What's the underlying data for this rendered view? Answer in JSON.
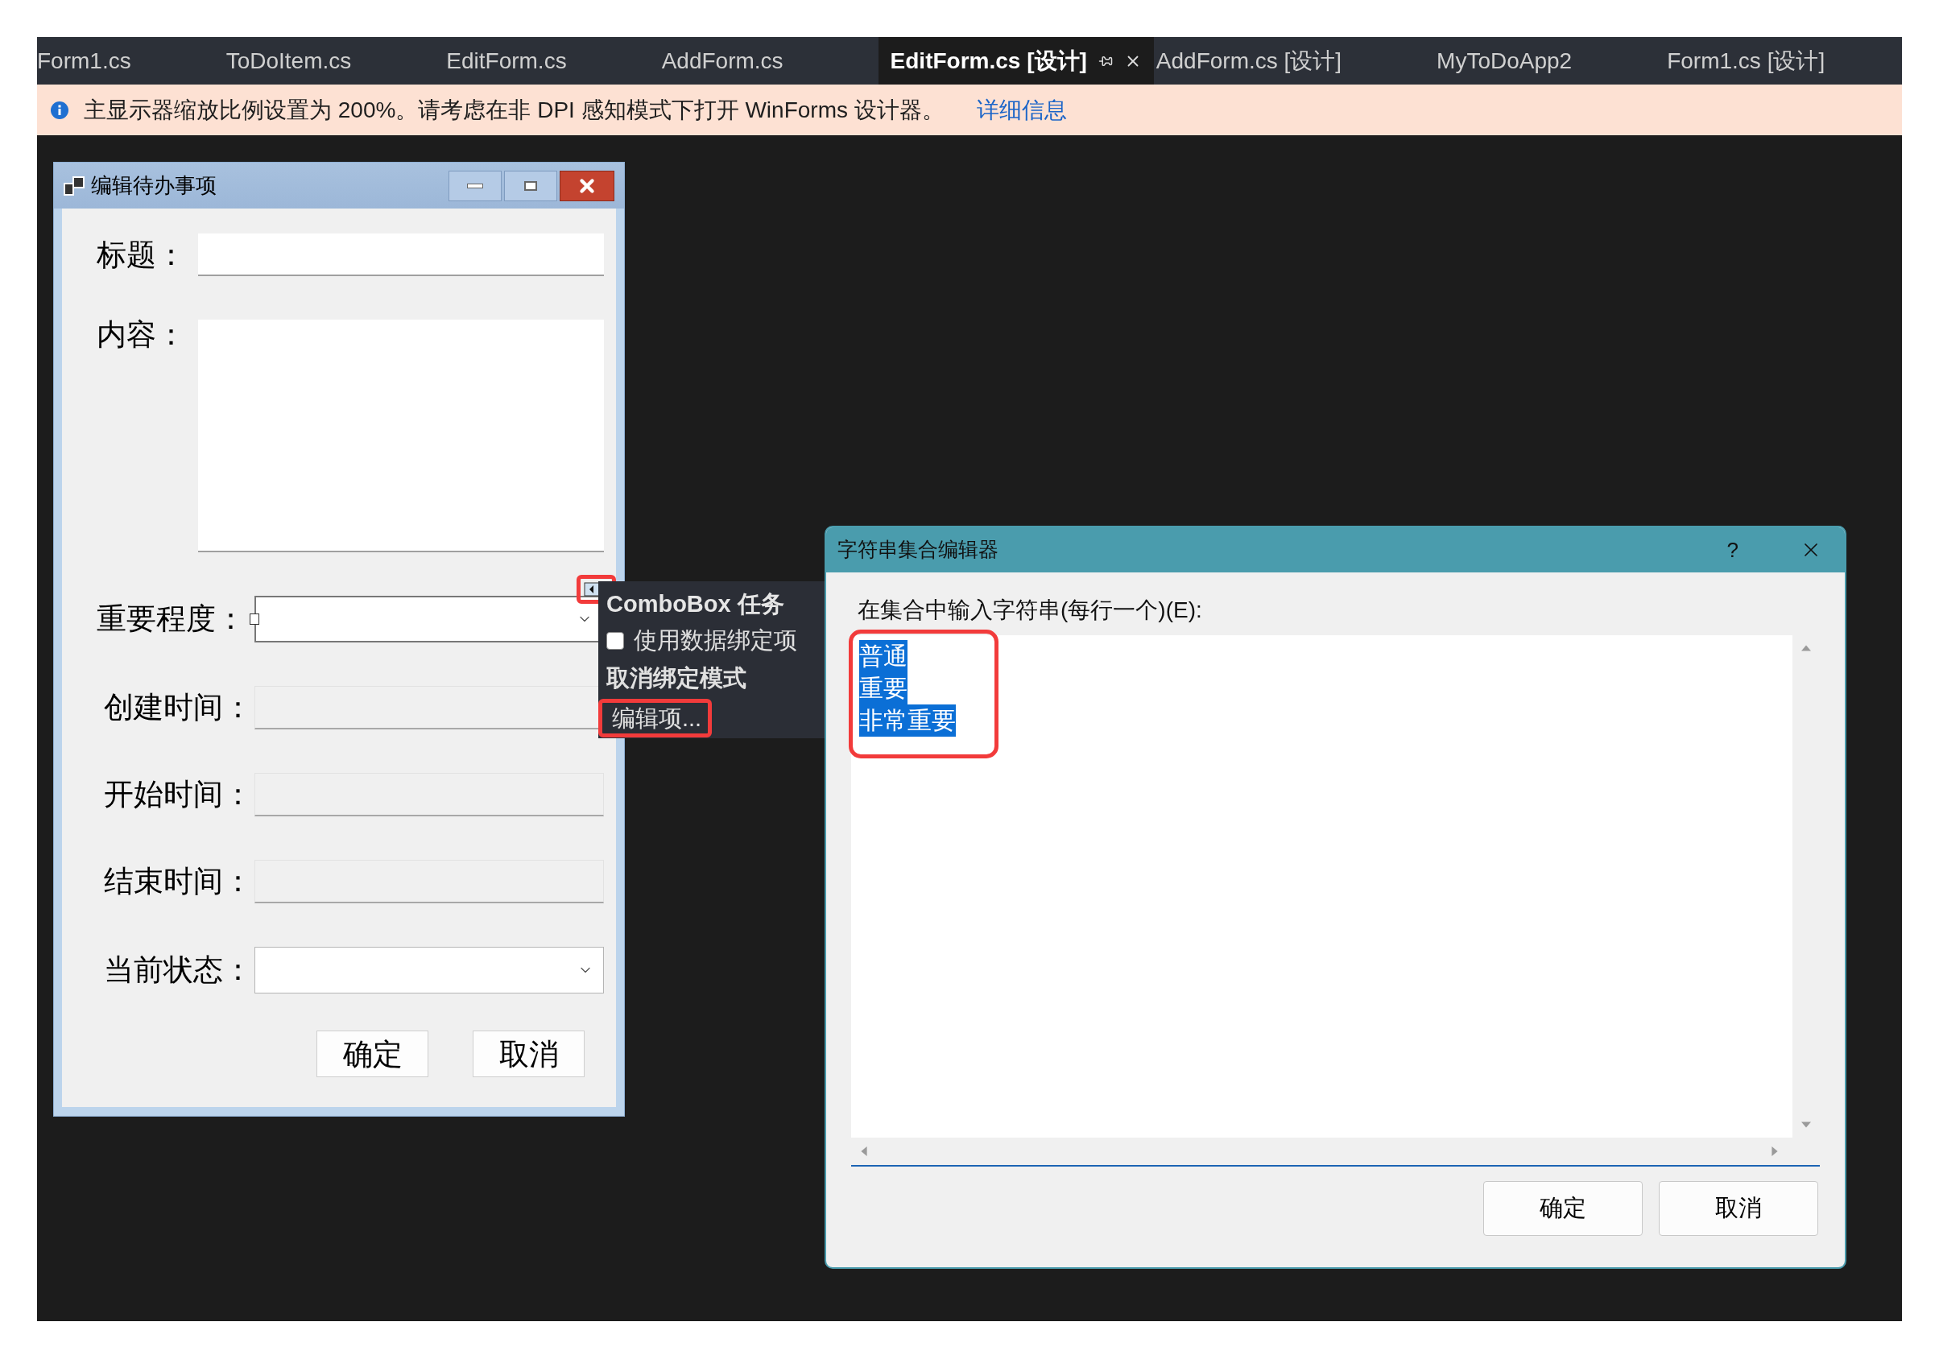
{
  "tabs": [
    {
      "label": "Form1.cs",
      "selected": false
    },
    {
      "label": "ToDoItem.cs",
      "selected": false
    },
    {
      "label": "EditForm.cs",
      "selected": false
    },
    {
      "label": "AddForm.cs",
      "selected": false
    },
    {
      "label": "EditForm.cs [设计]",
      "selected": true
    },
    {
      "label": "AddForm.cs [设计]",
      "selected": false
    },
    {
      "label": "MyToDoApp2",
      "selected": false
    },
    {
      "label": "Form1.cs [设计]",
      "selected": false
    }
  ],
  "info_bar": {
    "message": "主显示器缩放比例设置为 200%。请考虑在非 DPI 感知模式下打开 WinForms 设计器。",
    "link": "详细信息"
  },
  "designer_form": {
    "title": "编辑待办事项",
    "fields": [
      {
        "label": "标题：",
        "kind": "textbox"
      },
      {
        "label": "内容：",
        "kind": "multiline"
      },
      {
        "label": "重要程度：",
        "kind": "combobox",
        "selected": true
      },
      {
        "label": "创建时间：",
        "kind": "datetime"
      },
      {
        "label": "开始时间：",
        "kind": "datetime"
      },
      {
        "label": "结束时间：",
        "kind": "datetime"
      },
      {
        "label": "当前状态：",
        "kind": "combobox",
        "selected": false
      }
    ],
    "buttons": [
      "确定",
      "取消"
    ]
  },
  "smart_tag": {
    "glyph_highlighted": true,
    "title": "ComboBox 任务",
    "items": [
      {
        "kind": "checkbox",
        "label": "使用数据绑定项",
        "checked": false,
        "highlighted": false
      },
      {
        "kind": "action",
        "label": "取消绑定模式",
        "highlighted": false
      },
      {
        "kind": "link",
        "label": "编辑项...",
        "highlighted": true
      }
    ]
  },
  "dialog": {
    "title": "字符串集合编辑器",
    "help": "?",
    "prompt": "在集合中输入字符串(每行一个)(E):",
    "lines": [
      "普通",
      "重要",
      "非常重要"
    ],
    "lines_selected": true,
    "lines_highlighted": true,
    "buttons": [
      "确定",
      "取消"
    ]
  }
}
